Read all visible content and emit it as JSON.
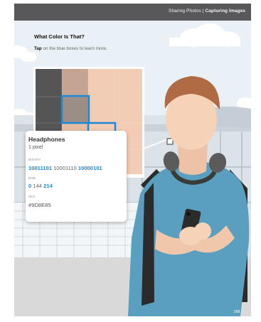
{
  "header": {
    "section": "Sharing Photos",
    "separator": " | ",
    "chapter": "Capturing Images"
  },
  "lesson": {
    "heading": "What Color Is That?",
    "instruction_bold": "Tap",
    "instruction_rest": " on the blue boxes to learn more."
  },
  "color_popup": {
    "title": "Headphones",
    "subtitle": "1 pixel",
    "binary_label": "BINARY",
    "binary": [
      "10011101",
      "10001110",
      "10000101"
    ],
    "rgb_label": "RGB",
    "rgb": [
      "0",
      "144",
      "214"
    ],
    "hex_label": "HEX",
    "hex": "#9D8E85"
  },
  "page_number": "268",
  "colors": {
    "accent": "#1a8ad8",
    "topbar": "#58585b",
    "shirt": "#5a9fbf",
    "hair": "#b06b44",
    "skin": "#f5d2b8"
  }
}
